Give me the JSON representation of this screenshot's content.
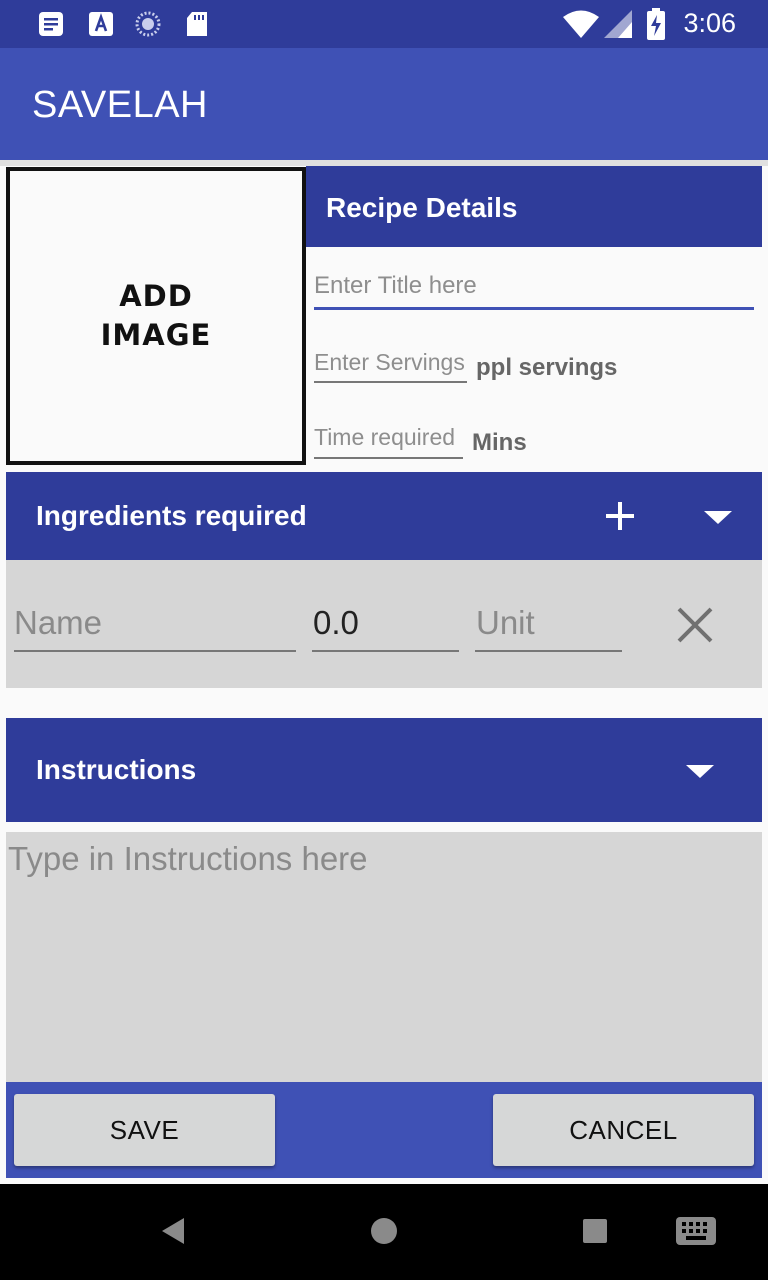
{
  "status_bar": {
    "time": "3:06",
    "icons": [
      "notes-icon",
      "font-icon",
      "loading-icon",
      "sd-card-icon",
      "wifi-icon",
      "signal-icon",
      "battery-charging-icon"
    ]
  },
  "app_bar": {
    "title": "SAVELAH"
  },
  "image_picker": {
    "label": "ADD\nIMAGE"
  },
  "recipe_details": {
    "header": "Recipe Details",
    "title_placeholder": "Enter Title here",
    "servings_placeholder": "Enter Servings",
    "servings_unit": "ppl servings",
    "time_placeholder": "Time required",
    "time_unit": "Mins"
  },
  "ingredients": {
    "header": "Ingredients required",
    "add_icon": "plus-icon",
    "toggle_icon": "dropdown-arrow-icon",
    "rows": [
      {
        "name_placeholder": "Name",
        "quantity": "0.0",
        "unit_placeholder": "Unit",
        "remove_icon": "close-icon"
      }
    ]
  },
  "instructions": {
    "header": "Instructions",
    "toggle_icon": "dropdown-arrow-icon",
    "placeholder": "Type in Instructions here"
  },
  "actions": {
    "save": "SAVE",
    "cancel": "CANCEL"
  },
  "nav_bar": {
    "icons": [
      "back-icon",
      "home-icon",
      "recents-icon",
      "keyboard-icon"
    ]
  },
  "colors": {
    "primary": "#3f51b5",
    "primary_dark": "#2f3c9a",
    "field_bg": "#d6d6d6",
    "button": "#d6d7d7"
  }
}
